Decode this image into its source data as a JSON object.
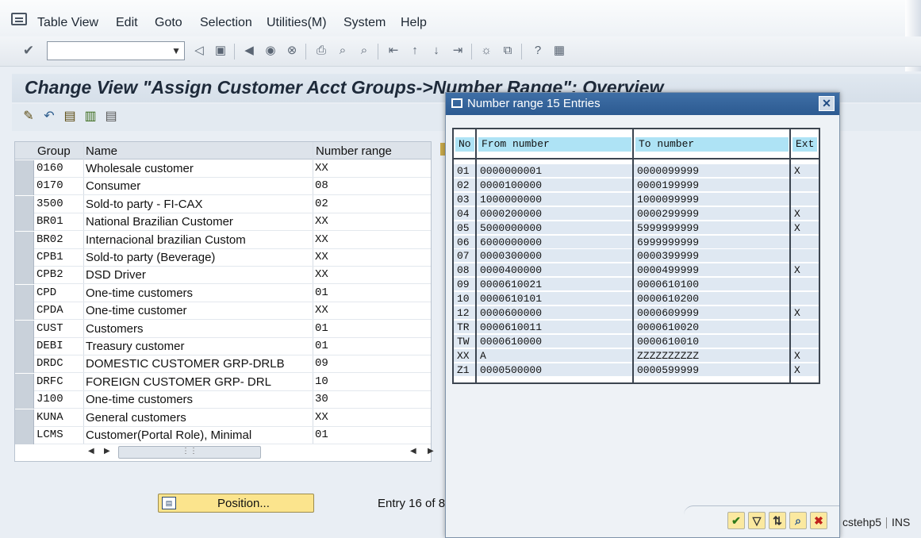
{
  "menubar": {
    "items": [
      "Table View",
      "Edit",
      "Goto",
      "Selection",
      "Utilities(M)",
      "System",
      "Help"
    ]
  },
  "toolbar": {
    "command_field_value": "",
    "icons": [
      "check-icon",
      "back-icon",
      "save-icon",
      "exit-icon",
      "cancel-icon",
      "print-icon",
      "find-icon",
      "find-next-icon",
      "first-page-icon",
      "prev-page-icon",
      "next-page-icon",
      "last-page-icon",
      "create-session-icon",
      "shortcut-icon",
      "help-icon",
      "customize-icon"
    ]
  },
  "title": "Change View \"Assign Customer Acct Groups->Number Range\": Overview",
  "table": {
    "headers": [
      "Group",
      "Name",
      "Number range"
    ],
    "rows": [
      {
        "group": "0160",
        "name": "Wholesale customer",
        "range": "XX"
      },
      {
        "group": "0170",
        "name": "Consumer",
        "range": "08"
      },
      {
        "group": "3500",
        "name": "Sold-to party - FI-CAX",
        "range": "02"
      },
      {
        "group": "BR01",
        "name": "National  Brazilian Customer",
        "range": "XX"
      },
      {
        "group": "BR02",
        "name": "Internacional brazilian Custom",
        "range": "XX"
      },
      {
        "group": "CPB1",
        "name": "Sold-to party (Beverage)",
        "range": "XX"
      },
      {
        "group": "CPB2",
        "name": "DSD Driver",
        "range": "XX"
      },
      {
        "group": "CPD",
        "name": "One-time customers",
        "range": "01"
      },
      {
        "group": "CPDA",
        "name": "One-time customer",
        "range": "XX"
      },
      {
        "group": "CUST",
        "name": "Customers",
        "range": "01"
      },
      {
        "group": "DEBI",
        "name": "Treasury customer",
        "range": "01"
      },
      {
        "group": "DRDC",
        "name": "DOMESTIC CUSTOMER GRP-DRLB",
        "range": "09"
      },
      {
        "group": "DRFC",
        "name": "FOREIGN CUSTOMER GRP- DRL",
        "range": "10"
      },
      {
        "group": "J100",
        "name": "One-time customers",
        "range": "30"
      },
      {
        "group": "KUNA",
        "name": "General customers",
        "range": "XX"
      },
      {
        "group": "LCMS",
        "name": "Customer(Portal Role), Minimal",
        "range": "01"
      }
    ]
  },
  "position_button": "Position...",
  "entry_text": "Entry 16 of 8",
  "dialog": {
    "title": "Number range 15 Entries",
    "headers": [
      "No",
      "From number",
      "To number",
      "Ext"
    ],
    "rows": [
      {
        "no": "01",
        "from": "0000000001",
        "to": "0000099999",
        "ext": "X"
      },
      {
        "no": "02",
        "from": "0000100000",
        "to": "0000199999",
        "ext": ""
      },
      {
        "no": "03",
        "from": "1000000000",
        "to": "1000099999",
        "ext": ""
      },
      {
        "no": "04",
        "from": "0000200000",
        "to": "0000299999",
        "ext": "X"
      },
      {
        "no": "05",
        "from": "5000000000",
        "to": "5999999999",
        "ext": "X"
      },
      {
        "no": "06",
        "from": "6000000000",
        "to": "6999999999",
        "ext": ""
      },
      {
        "no": "07",
        "from": "0000300000",
        "to": "0000399999",
        "ext": ""
      },
      {
        "no": "08",
        "from": "0000400000",
        "to": "0000499999",
        "ext": "X"
      },
      {
        "no": "09",
        "from": "0000610021",
        "to": "0000610100",
        "ext": ""
      },
      {
        "no": "10",
        "from": "0000610101",
        "to": "0000610200",
        "ext": ""
      },
      {
        "no": "12",
        "from": "0000600000",
        "to": "0000609999",
        "ext": "X"
      },
      {
        "no": "TR",
        "from": "0000610011",
        "to": "0000610020",
        "ext": ""
      },
      {
        "no": "TW",
        "from": "0000610000",
        "to": "0000610010",
        "ext": ""
      },
      {
        "no": "XX",
        "from": "A",
        "to": "ZZZZZZZZZZ",
        "ext": "X"
      },
      {
        "no": "Z1",
        "from": "0000500000",
        "to": "0000599999",
        "ext": "X"
      }
    ],
    "footer_buttons": [
      "confirm-icon",
      "filter-icon",
      "sort-icon",
      "find-icon",
      "cancel-icon"
    ]
  },
  "status": {
    "system": "cstehp5",
    "mode": "INS"
  }
}
